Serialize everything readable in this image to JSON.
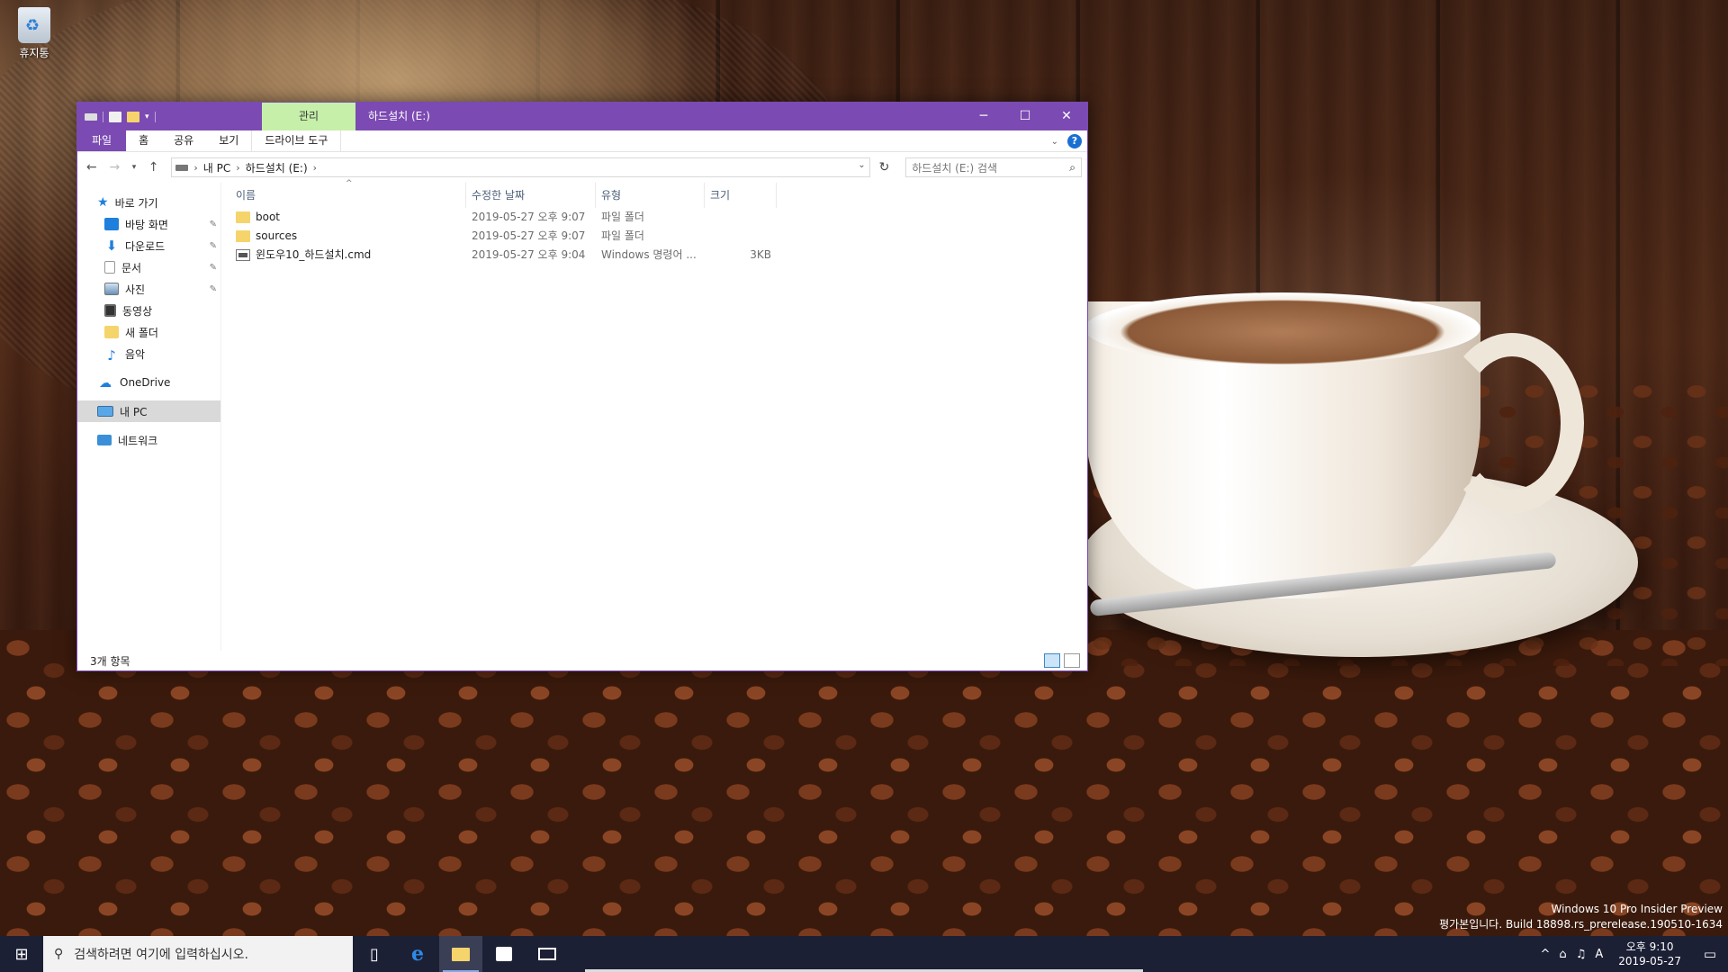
{
  "desktop": {
    "recycle_bin_label": "휴지통",
    "watermark": {
      "line1": "Windows 10 Pro Insider Preview",
      "line2": "평가본입니다. Build 18898.rs_prerelease.190510-1634"
    }
  },
  "window": {
    "title": "하드설치 (E:)",
    "contextual_tab": "관리",
    "controls": {
      "minimize": "─",
      "maximize": "☐",
      "close": "✕"
    },
    "ribbon_tabs": [
      "파일",
      "홈",
      "공유",
      "보기",
      "드라이브 도구"
    ],
    "address": {
      "segments": [
        "내 PC",
        "하드설치 (E:)"
      ]
    },
    "search_placeholder": "하드설치 (E:) 검색",
    "nav": {
      "quick_access": "바로 가기",
      "pinned": [
        "바탕 화면",
        "다운로드",
        "문서",
        "사진"
      ],
      "others": [
        "동영상",
        "새 폴더",
        "음악"
      ],
      "onedrive": "OneDrive",
      "this_pc": "내 PC",
      "network": "네트워크"
    },
    "columns": {
      "name": "이름",
      "date": "수정한 날짜",
      "type": "유형",
      "size": "크기"
    },
    "files": [
      {
        "name": "boot",
        "date": "2019-05-27 오후 9:07",
        "type": "파일 폴더",
        "size": "",
        "icon": "folder-icon"
      },
      {
        "name": "sources",
        "date": "2019-05-27 오후 9:07",
        "type": "파일 폴더",
        "size": "",
        "icon": "folder-icon"
      },
      {
        "name": "윈도우10_하드설치.cmd",
        "date": "2019-05-27 오후 9:04",
        "type": "Windows 명령어 ...",
        "size": "3KB",
        "icon": "cmd-file-icon"
      }
    ],
    "status": "3개 항목",
    "accent_color": "#7b4ab2",
    "manage_tab_color": "#c6efa9"
  },
  "taskbar": {
    "search_placeholder": "검색하려면 여기에 입력하십시오.",
    "tray_ime": "A",
    "clock_time": "오후 9:10",
    "clock_date": "2019-05-27"
  }
}
